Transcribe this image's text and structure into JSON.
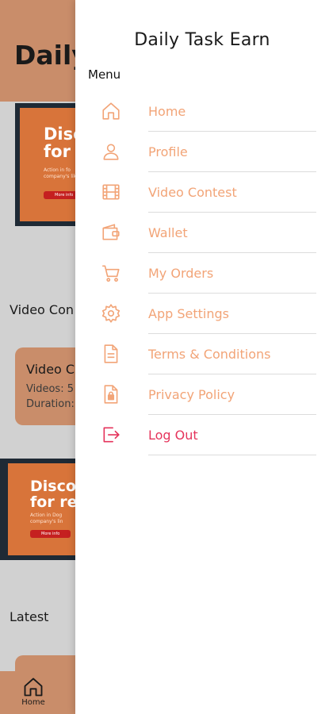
{
  "background": {
    "header_title": "Daily",
    "banner1": {
      "headline": "Disco\nfor r",
      "small_text": "Action in fo\ncompany's lik",
      "button": "More info"
    },
    "section_video": "Video Con",
    "card": {
      "title": "Video C",
      "videos": "Videos: 5",
      "duration": "Duration:"
    },
    "banner2": {
      "headline": "Disco\nfor re",
      "small_text": "Action in Dog\ncompany's lin",
      "button": "More info"
    },
    "section_latest": "Latest",
    "bottom_nav": {
      "home_label": "Home",
      "icon": "home-icon"
    }
  },
  "drawer": {
    "title": "Daily Task Earn",
    "menu_label": "Menu",
    "items": [
      {
        "label": "Home",
        "icon": "home-icon"
      },
      {
        "label": "Profile",
        "icon": "user-icon"
      },
      {
        "label": "Video Contest",
        "icon": "film-icon"
      },
      {
        "label": "Wallet",
        "icon": "wallet-icon"
      },
      {
        "label": "My Orders",
        "icon": "cart-icon"
      },
      {
        "label": "App Settings",
        "icon": "gear-icon"
      },
      {
        "label": "Terms & Conditions",
        "icon": "document-icon"
      },
      {
        "label": "Privacy Policy",
        "icon": "lock-document-icon"
      },
      {
        "label": "Log Out",
        "icon": "logout-icon"
      }
    ]
  },
  "colors": {
    "accent": "#f2a477",
    "logout": "#e5345c",
    "header_bg": "#c98d6a",
    "banner_bg": "#d8743a"
  }
}
